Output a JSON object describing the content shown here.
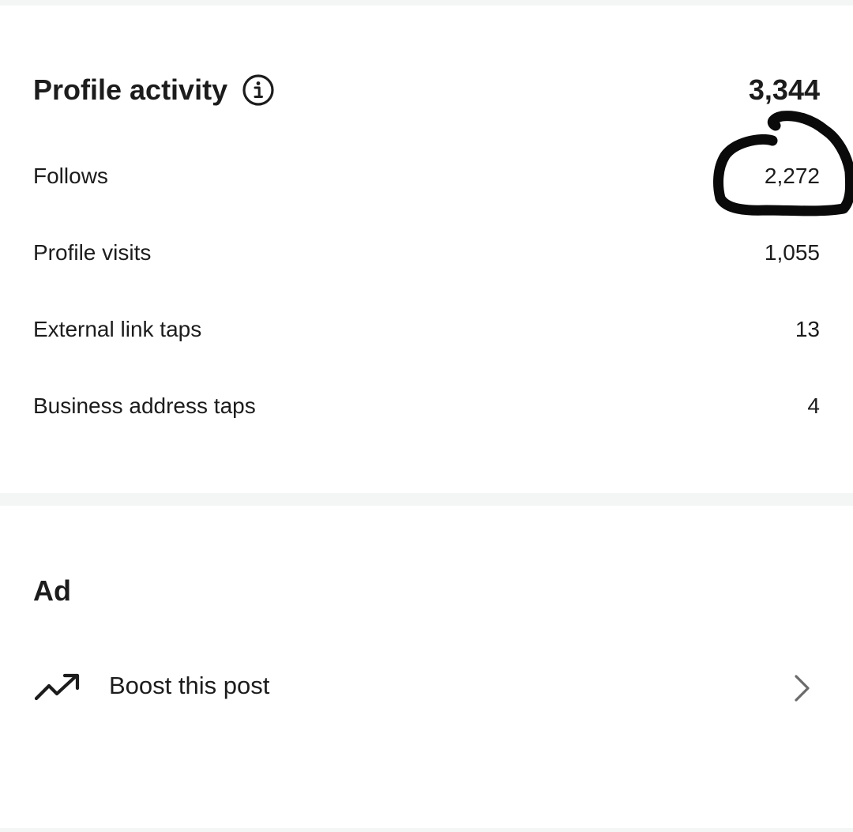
{
  "profile_activity": {
    "title": "Profile activity",
    "total": "3,344",
    "info_icon": "info-icon",
    "rows": [
      {
        "label": "Follows",
        "value": "2,272"
      },
      {
        "label": "Profile visits",
        "value": "1,055"
      },
      {
        "label": "External link taps",
        "value": "13"
      },
      {
        "label": "Business address taps",
        "value": "4"
      }
    ],
    "annotation": "hand-drawn-circle-around-follows-value"
  },
  "ad": {
    "title": "Ad",
    "boost_label": "Boost this post",
    "boost_icon": "trending-up-icon",
    "chevron_icon": "chevron-right-icon"
  },
  "colors": {
    "text": "#1c1c1c",
    "background": "#ffffff",
    "divider": "#f4f5f5",
    "chevron": "#6b6b6b",
    "scribble": "#0a0a0a"
  }
}
